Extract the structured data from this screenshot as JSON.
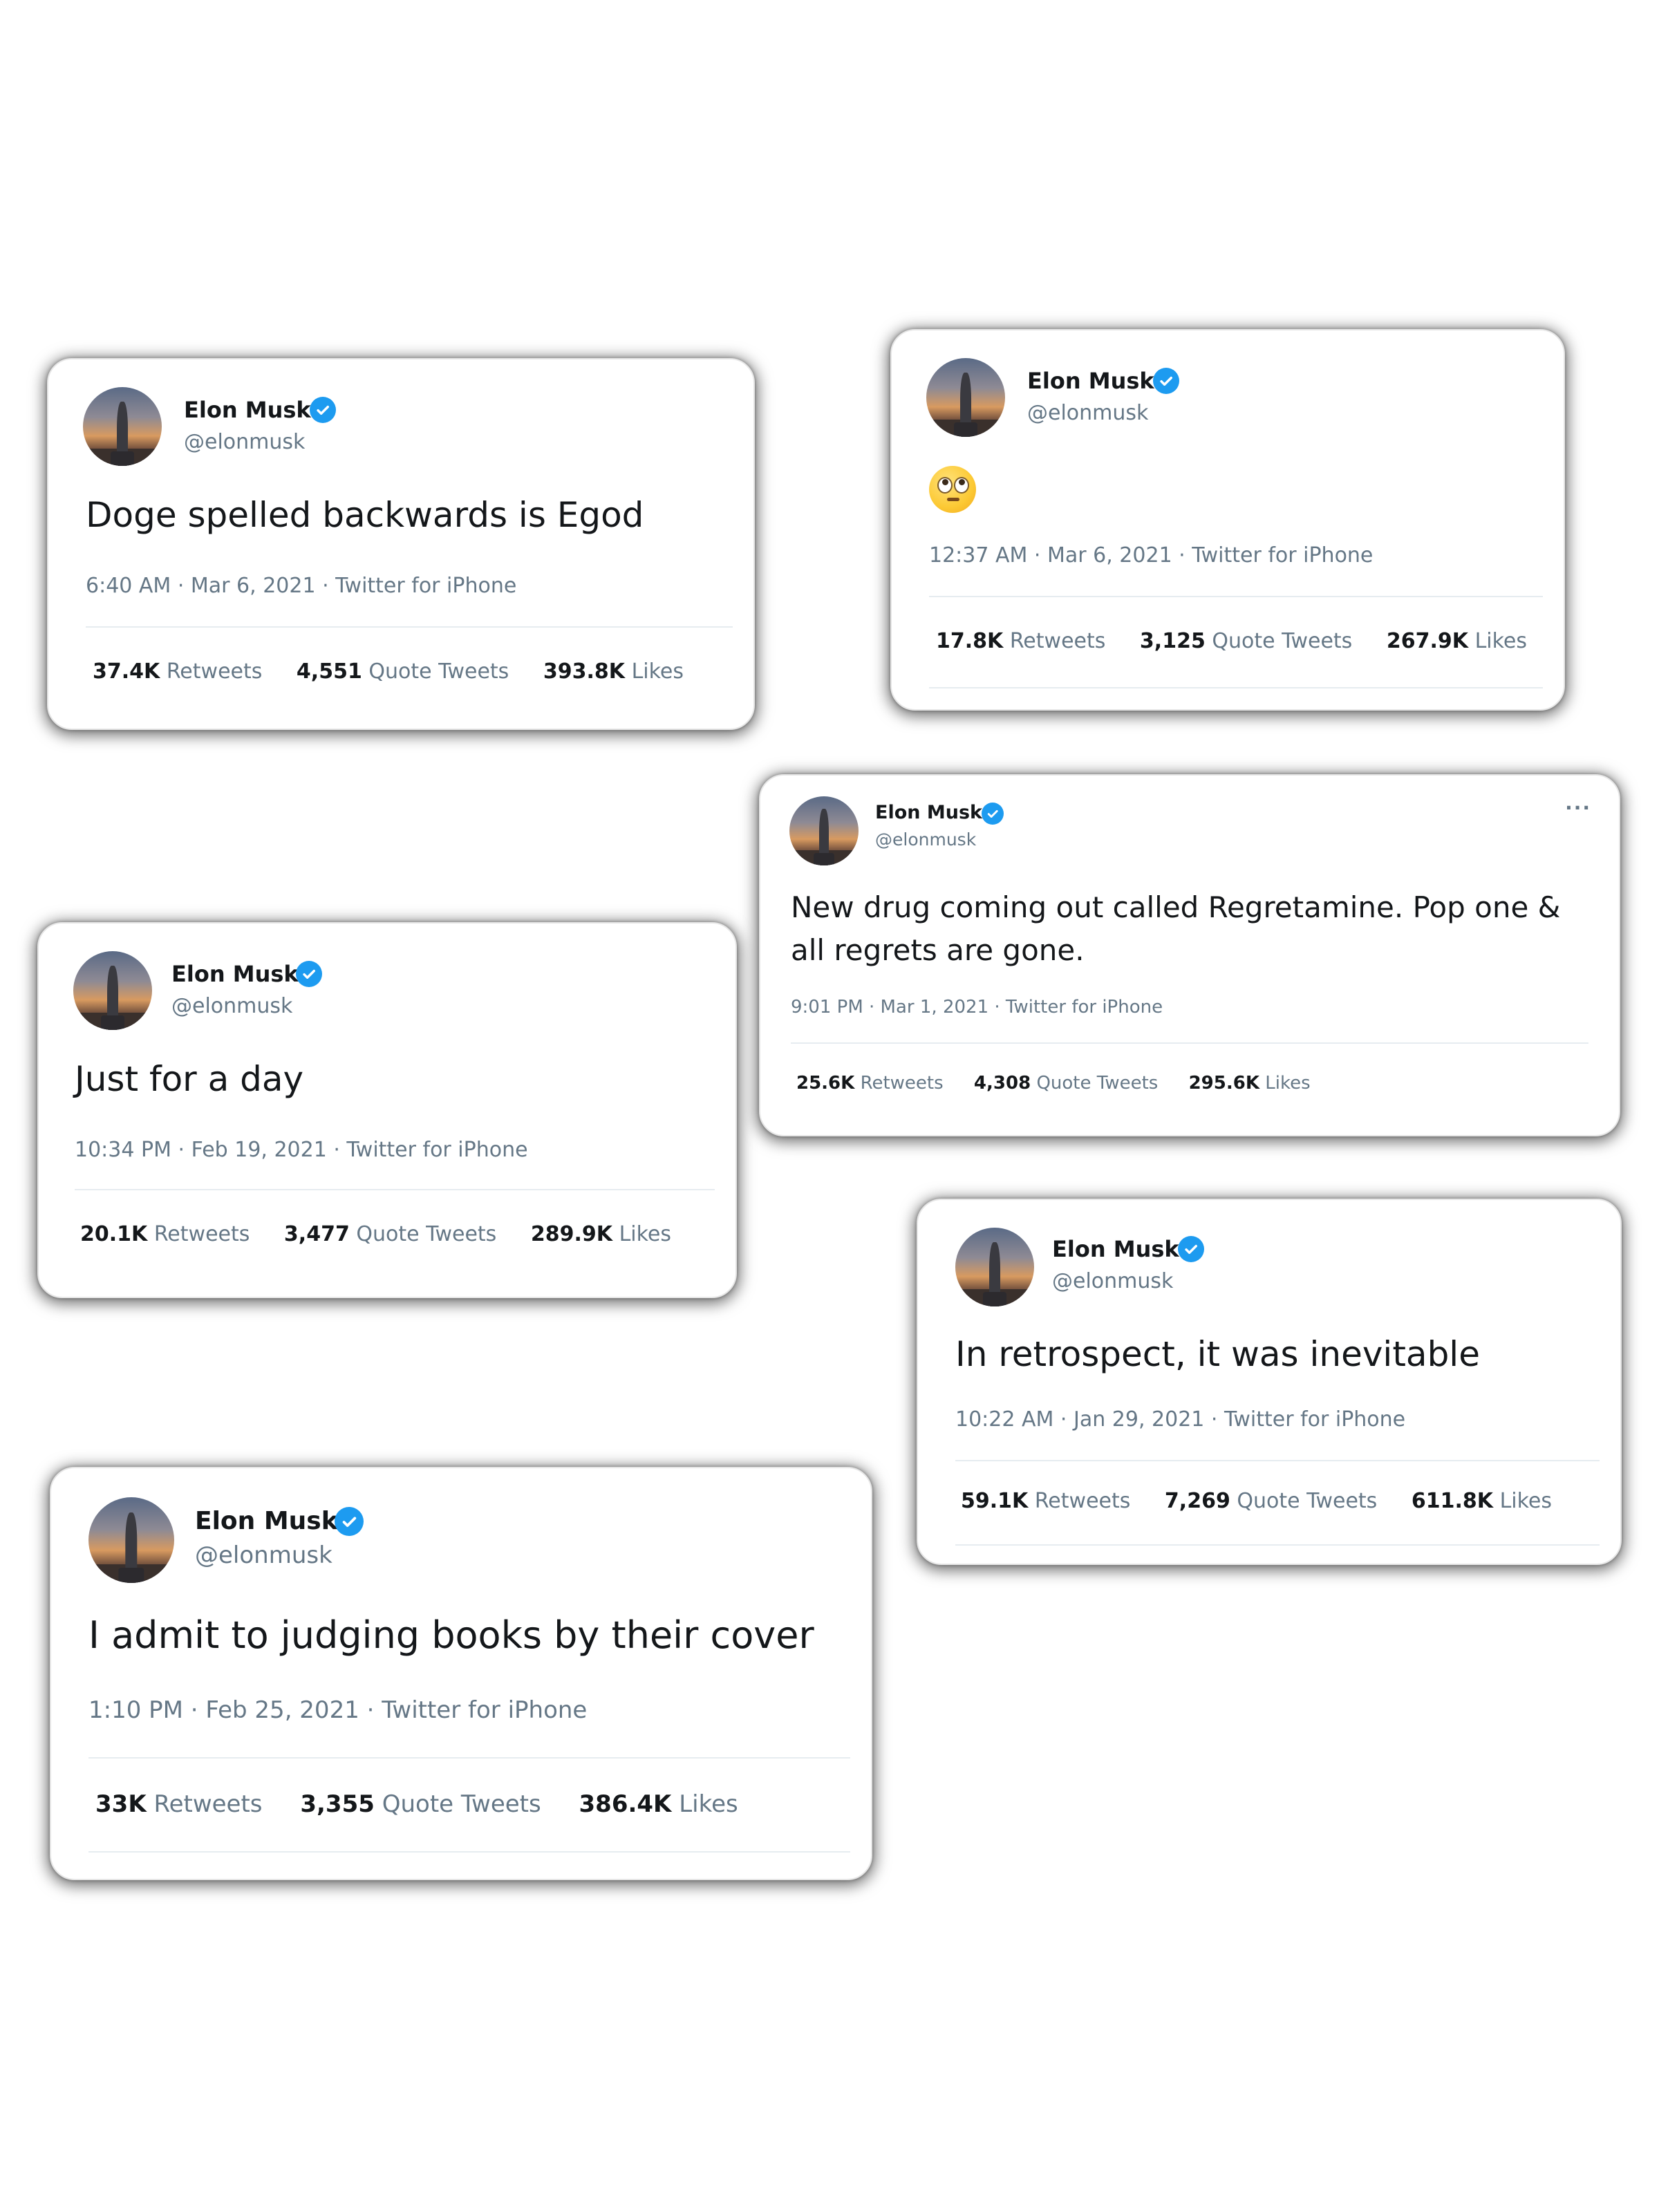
{
  "author": {
    "name": "Elon Musk",
    "handle": "@elonmusk",
    "verified_color": "#1d9bf0"
  },
  "tweets": [
    {
      "text": "Doge spelled backwards is Egod",
      "meta": "6:40 AM · Mar 6, 2021 · Twitter for iPhone",
      "retweets": "37.4K",
      "retweets_label": "Retweets",
      "quotes": "4,551",
      "quotes_label": "Quote Tweets",
      "likes": "393.8K",
      "likes_label": "Likes"
    },
    {
      "emoji": "face-with-rolling-eyes",
      "meta": "12:37 AM · Mar 6, 2021 · Twitter for iPhone",
      "retweets": "17.8K",
      "retweets_label": "Retweets",
      "quotes": "3,125",
      "quotes_label": "Quote Tweets",
      "likes": "267.9K",
      "likes_label": "Likes"
    },
    {
      "text_line1": "New drug coming out called Regretamine. Pop one &",
      "text_line2": "all regrets are gone.",
      "meta": "9:01 PM · Mar 1, 2021 · Twitter for iPhone",
      "retweets": "25.6K",
      "retweets_label": "Retweets",
      "quotes": "4,308",
      "quotes_label": "Quote Tweets",
      "likes": "295.6K",
      "likes_label": "Likes",
      "more_label": "···"
    },
    {
      "text": "Just for a day",
      "meta": "10:34 PM · Feb 19, 2021 · Twitter for iPhone",
      "retweets": "20.1K",
      "retweets_label": "Retweets",
      "quotes": "3,477",
      "quotes_label": "Quote Tweets",
      "likes": "289.9K",
      "likes_label": "Likes"
    },
    {
      "text": "In retrospect, it was inevitable",
      "meta": "10:22 AM · Jan 29, 2021 · Twitter for iPhone",
      "retweets": "59.1K",
      "retweets_label": "Retweets",
      "quotes": "7,269",
      "quotes_label": "Quote Tweets",
      "likes": "611.8K",
      "likes_label": "Likes"
    },
    {
      "text": "I admit to judging books by their cover",
      "meta": "1:10 PM · Feb 25, 2021 · Twitter for iPhone",
      "retweets": "33K",
      "retweets_label": "Retweets",
      "quotes": "3,355",
      "quotes_label": "Quote Tweets",
      "likes": "386.4K",
      "likes_label": "Likes"
    }
  ]
}
